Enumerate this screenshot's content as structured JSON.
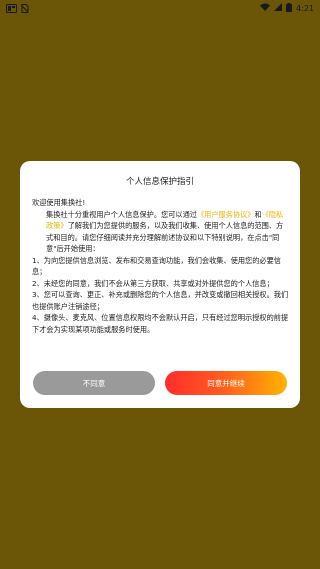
{
  "status_bar": {
    "time": "4:21",
    "left_icons": [
      "app-notification-icon",
      "no-sim-icon"
    ],
    "right_icons": [
      "wifi-icon",
      "signal-icon",
      "battery-icon"
    ]
  },
  "dialog": {
    "title": "个人信息保护指引",
    "greeting": "欢迎使用集换社!",
    "intro_part1": "集换社十分重视用户个人信息保护。您可以通过",
    "link_user_agreement": "《用户服务协议》",
    "intro_and": "和",
    "link_privacy": "《隐私政策》",
    "intro_part2": "了解我们为您提供的服务，以及我们收集、使用个人信息的范围、方式和目的。请您仔细阅读并充分理解前述协议和以下特别说明，在点击\"同意\"后开始使用：",
    "item1": "1、为向您提供信息浏览、发布和交易查询功能，我们会收集、使用您的必要信息；",
    "item2": "2、未经您的同意，我们不会从第三方获取、共享或对外提供您的个人信息；",
    "item3": "3、您可以查询、更正、补充或删除您的个人信息，并改变或撤回相关授权。我们也提供账户注销途径；",
    "item4": "4、摄像头、麦克风、位置信息权限均不会默认开启，只有经过您明示授权的前提下才会为实现某项功能或服务时使用。",
    "disagree_label": "不同意",
    "agree_label": "同意并继续"
  },
  "colors": {
    "background": "#6b5608",
    "link": "#e8b400",
    "disagree_button": "#9a9a9a",
    "agree_gradient": [
      "#ff2d2d",
      "#ffb300"
    ]
  }
}
